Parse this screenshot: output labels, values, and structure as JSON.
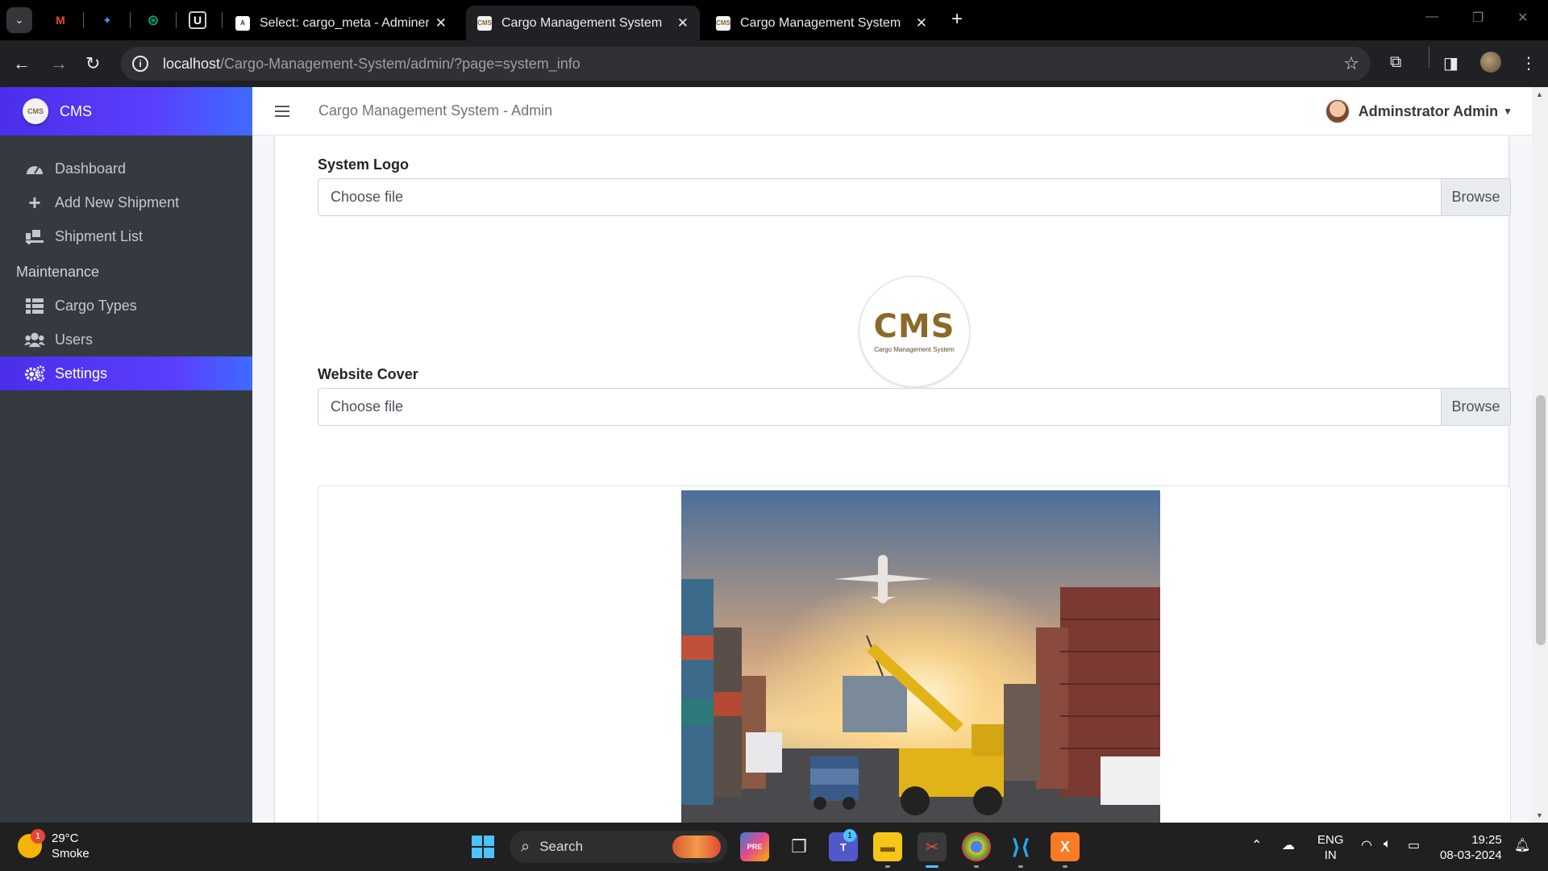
{
  "browser": {
    "tabs": [
      {
        "title": "Select: cargo_meta - Adminer",
        "active": false
      },
      {
        "title": "Cargo Management System",
        "active": true
      },
      {
        "title": "Cargo Management System",
        "active": false
      }
    ],
    "url_host": "localhost",
    "url_path": "/Cargo-Management-System/admin/?page=system_info"
  },
  "sidebar": {
    "brand": "CMS",
    "items": [
      {
        "label": "Dashboard",
        "icon": "tachometer-icon"
      },
      {
        "label": "Add New Shipment",
        "icon": "plus-icon"
      },
      {
        "label": "Shipment List",
        "icon": "truck-loading-icon"
      }
    ],
    "header": "Maintenance",
    "maintenance_items": [
      {
        "label": "Cargo Types",
        "icon": "list-icon"
      },
      {
        "label": "Users",
        "icon": "users-icon"
      },
      {
        "label": "Settings",
        "icon": "cogs-icon",
        "active": true
      }
    ]
  },
  "topnav": {
    "title": "Cargo Management System - Admin",
    "user": "Adminstrator Admin"
  },
  "form": {
    "logo_label": "System Logo",
    "logo_placeholder": "Choose file",
    "browse": "Browse",
    "logo_text": "CMS",
    "logo_subtext": "Cargo Management System",
    "cover_label": "Website Cover",
    "cover_placeholder": "Choose file"
  },
  "taskbar": {
    "temp": "29°C",
    "condition": "Smoke",
    "weather_badge": "1",
    "search": "Search",
    "teams_badge": "1",
    "lang1": "ENG",
    "lang2": "IN",
    "time": "19:25",
    "date": "08-03-2024"
  },
  "colors": {
    "sidebar_bg": "#343a40",
    "accent": "#5a3fff",
    "brand_gold": "#8a6a2a"
  }
}
